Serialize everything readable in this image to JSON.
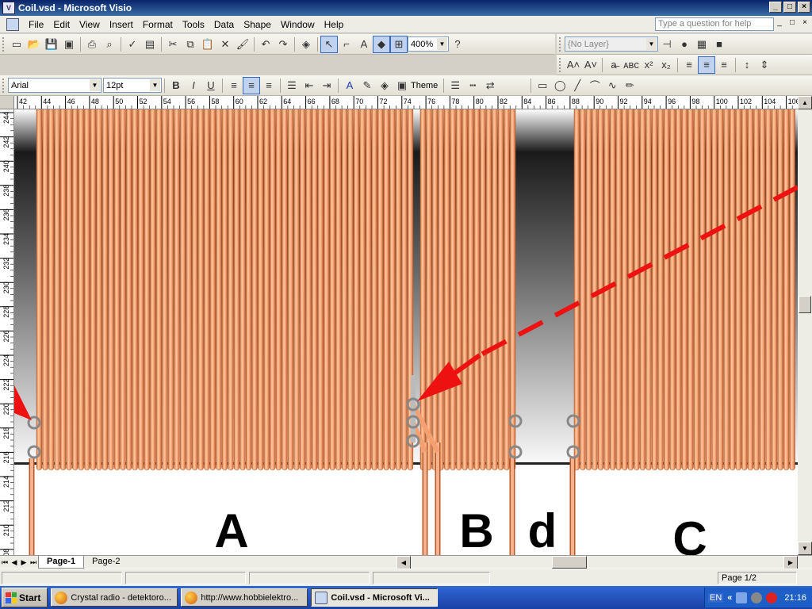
{
  "window": {
    "title": "Coil.vsd - Microsoft Visio",
    "minimize": "_",
    "maximize": "□",
    "close": "×"
  },
  "menu": {
    "items": [
      "File",
      "Edit",
      "View",
      "Insert",
      "Format",
      "Tools",
      "Data",
      "Shape",
      "Window",
      "Help"
    ],
    "help_placeholder": "Type a question for help",
    "mdi_buttons": [
      "_",
      "□",
      "×"
    ]
  },
  "standard_toolbar": {
    "zoom": "400%",
    "layer": "{No Layer}"
  },
  "format_toolbar": {
    "font": "Arial",
    "size": "12pt",
    "theme_label": "Theme"
  },
  "ruler": {
    "h_ticks": [
      "42",
      "44",
      "46",
      "48",
      "50",
      "52",
      "54",
      "56",
      "58",
      "60",
      "62",
      "64",
      "66",
      "68",
      "70",
      "72",
      "74",
      "76",
      "78",
      "80",
      "82",
      "84",
      "86",
      "88",
      "90",
      "92",
      "94",
      "96",
      "98",
      "100",
      "102",
      "104",
      "106"
    ],
    "v_ticks": [
      "244",
      "242",
      "240",
      "238",
      "236",
      "234",
      "232",
      "230",
      "228",
      "226",
      "224",
      "222",
      "220",
      "218",
      "216",
      "214",
      "212",
      "210",
      "208"
    ]
  },
  "drawing": {
    "labels": {
      "a": "A",
      "b": "B",
      "d": "d",
      "c": "C"
    },
    "colors": {
      "wire": "#f4a070",
      "wire_dark": "#c86838",
      "arrow": "#ee1111",
      "form_top": "#111111",
      "form_bottom": "#ffffff"
    }
  },
  "pages": {
    "tabs": [
      "Page-1",
      "Page-2"
    ],
    "active": "Page-1"
  },
  "status": {
    "page_indicator": "Page 1/2"
  },
  "taskbar": {
    "start": "Start",
    "tasks": [
      "Crystal radio - detektoro...",
      "http://www.hobbielektro...",
      "Coil.vsd - Microsoft Vi..."
    ],
    "active_task": "Coil.vsd - Microsoft Vi...",
    "lang": "EN",
    "chevron": "«",
    "clock": "21:16"
  }
}
